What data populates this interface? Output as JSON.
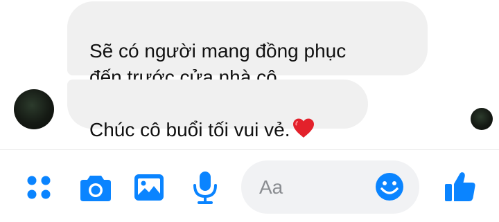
{
  "conversation": {
    "messages": [
      {
        "text": "Sẽ có người mang đồng phục\nđến trước cửa nhà cô.",
        "emoji": ""
      },
      {
        "text": "Chúc cô buổi tối vui vẻ.",
        "emoji": "❤️"
      }
    ]
  },
  "composer": {
    "placeholder": "Aa",
    "icons": [
      "more-apps-icon",
      "camera-icon",
      "gallery-icon",
      "microphone-icon",
      "emoji-icon",
      "like-icon"
    ],
    "accent_color": "#0a84ff"
  }
}
